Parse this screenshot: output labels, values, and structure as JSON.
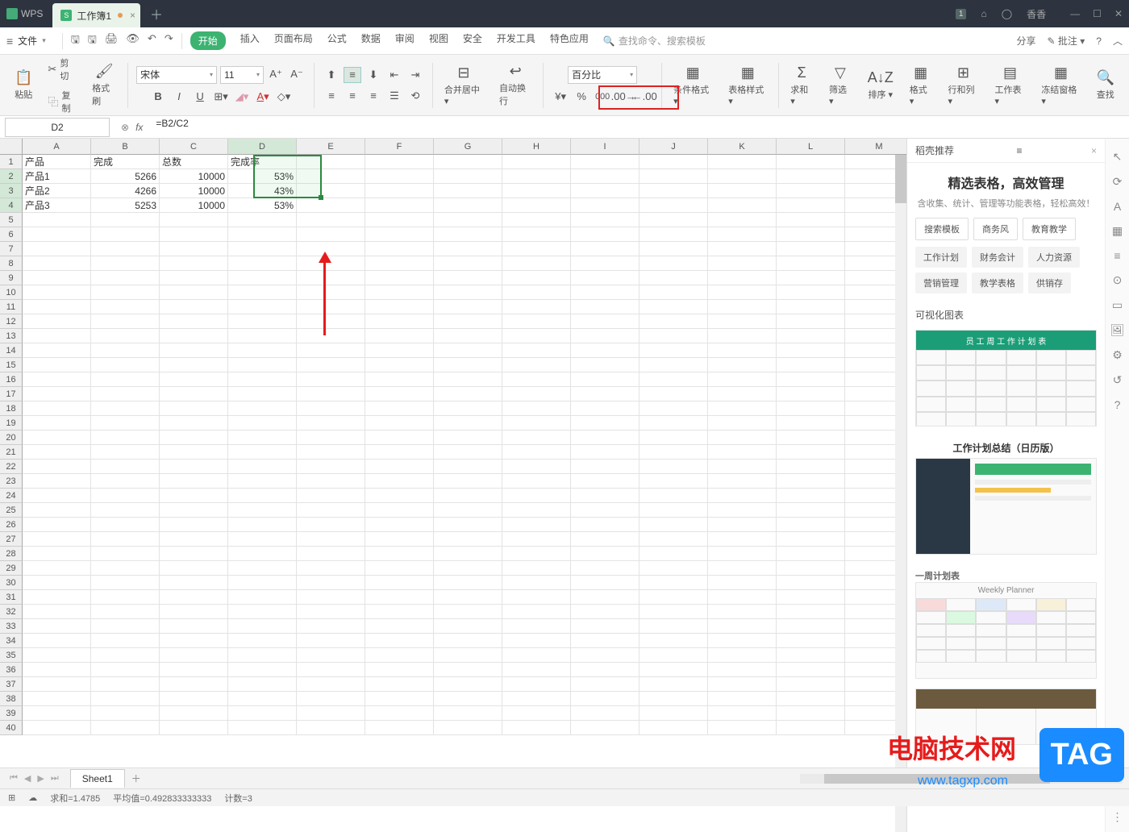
{
  "titlebar": {
    "app": "WPS",
    "doc_tab": "工作簿1",
    "user": "香香",
    "badge": "1"
  },
  "menu": {
    "file": "文件",
    "tabs": [
      "开始",
      "插入",
      "页面布局",
      "公式",
      "数据",
      "审阅",
      "视图",
      "安全",
      "开发工具",
      "特色应用"
    ],
    "search_placeholder": "查找命令、搜索模板",
    "share": "分享",
    "comment": "批注"
  },
  "ribbon": {
    "paste": "粘贴",
    "cut": "剪切",
    "copy": "复制",
    "format_painter": "格式刷",
    "font": "宋体",
    "font_size": "11",
    "merge": "合并居中",
    "wrap": "自动换行",
    "number_format": "百分比",
    "cond_format": "条件格式",
    "table_style": "表格样式",
    "sum": "求和",
    "filter": "筛选",
    "sort": "排序",
    "format": "格式",
    "row_col": "行和列",
    "sheet": "工作表",
    "freeze": "冻结窗格",
    "find": "查找"
  },
  "formula": {
    "cell_ref": "D2",
    "formula": "=B2/C2"
  },
  "columns": [
    "A",
    "B",
    "C",
    "D",
    "E",
    "F",
    "G",
    "H",
    "I",
    "J",
    "K",
    "L",
    "M"
  ],
  "sheet_data": {
    "headers": [
      "产品",
      "完成",
      "总数",
      "完成率"
    ],
    "rows": [
      {
        "name": "产品1",
        "done": "5266",
        "total": "10000",
        "rate": "53%"
      },
      {
        "name": "产品2",
        "done": "4266",
        "total": "10000",
        "rate": "43%"
      },
      {
        "name": "产品3",
        "done": "5253",
        "total": "10000",
        "rate": "53%"
      }
    ]
  },
  "right_panel": {
    "title_bar": "稻壳推荐",
    "headline": "精选表格，高效管理",
    "subtitle": "含收集、统计、管理等功能表格，轻松高效！",
    "pill_tags": [
      "搜索模板",
      "商务风",
      "教育教学"
    ],
    "grey_tags": [
      "工作计划",
      "财务会计",
      "人力资源",
      "营销管理",
      "教学表格",
      "供销存"
    ],
    "section": "可视化图表",
    "thumb1_header": "员 工 周 工 作 计 划 表",
    "thumb2_title": "工作计划总结（日历版）",
    "thumb3_title": "一周计划表",
    "thumb3_header": "Weekly  Planner"
  },
  "sheet_tabs": {
    "active": "Sheet1"
  },
  "status": {
    "sum": "求和=1.4785",
    "avg": "平均值=0.492833333333",
    "count": "计数=3"
  },
  "overlay": {
    "site_name": "电脑技术网",
    "tag": "TAG",
    "url": "www.tagxp.com"
  }
}
